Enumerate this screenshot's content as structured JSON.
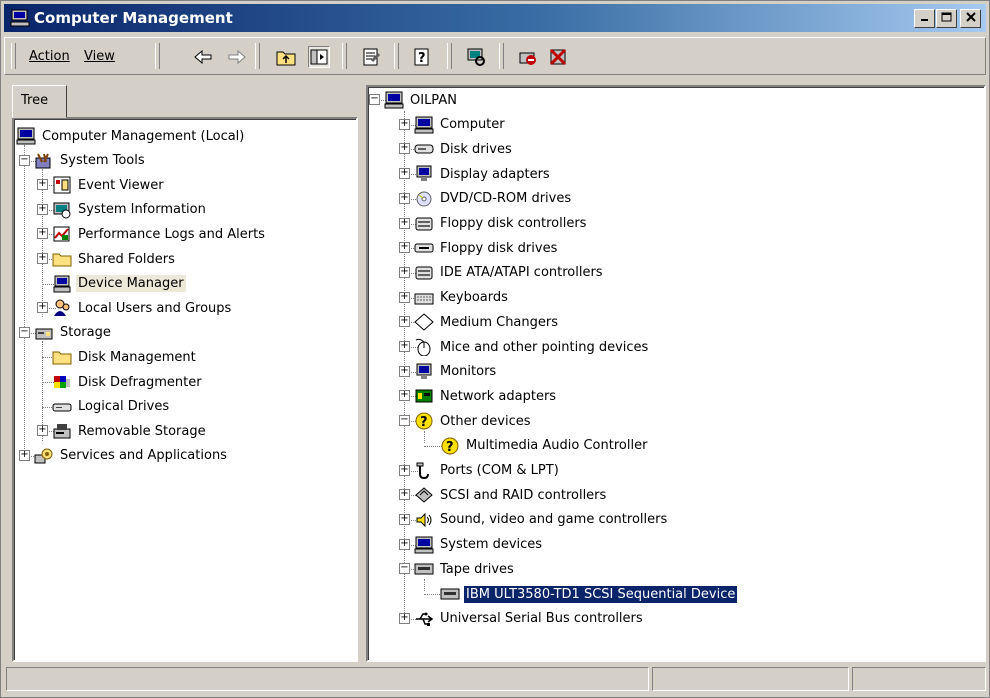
{
  "window": {
    "title": "Computer Management"
  },
  "menu": {
    "action": "Action",
    "view": "View"
  },
  "tab": {
    "tree": "Tree"
  },
  "left_tree": [
    {
      "label": "Computer Management (Local)",
      "icon": "computer-icon"
    },
    {
      "label": "System Tools",
      "icon": "tools-icon",
      "expander": "−"
    },
    {
      "label": "Event Viewer",
      "icon": "event-viewer-icon",
      "expander": "+"
    },
    {
      "label": "System Information",
      "icon": "system-info-icon",
      "expander": "+"
    },
    {
      "label": "Performance Logs and Alerts",
      "icon": "performance-icon",
      "expander": "+"
    },
    {
      "label": "Shared Folders",
      "icon": "folder-icon",
      "expander": "+"
    },
    {
      "label": "Device Manager",
      "icon": "device-manager-icon"
    },
    {
      "label": "Local Users and Groups",
      "icon": "users-icon",
      "expander": "+"
    },
    {
      "label": "Storage",
      "icon": "storage-icon",
      "expander": "−"
    },
    {
      "label": "Disk Management",
      "icon": "disk-management-icon"
    },
    {
      "label": "Disk Defragmenter",
      "icon": "defrag-icon"
    },
    {
      "label": "Logical Drives",
      "icon": "drive-icon"
    },
    {
      "label": "Removable Storage",
      "icon": "removable-storage-icon",
      "expander": "+"
    },
    {
      "label": "Services and Applications",
      "icon": "services-icon",
      "expander": "+"
    }
  ],
  "device_tree": [
    {
      "label": "OILPAN",
      "icon": "computer-icon",
      "expander": "−"
    },
    {
      "label": "Computer",
      "icon": "computer-icon",
      "expander": "+"
    },
    {
      "label": "Disk drives",
      "icon": "disk-drive-icon",
      "expander": "+"
    },
    {
      "label": "Display adapters",
      "icon": "monitor-icon",
      "expander": "+"
    },
    {
      "label": "DVD/CD-ROM drives",
      "icon": "cd-icon",
      "expander": "+"
    },
    {
      "label": "Floppy disk controllers",
      "icon": "controller-icon",
      "expander": "+"
    },
    {
      "label": "Floppy disk drives",
      "icon": "floppy-drive-icon",
      "expander": "+"
    },
    {
      "label": "IDE ATA/ATAPI controllers",
      "icon": "controller-icon",
      "expander": "+"
    },
    {
      "label": "Keyboards",
      "icon": "keyboard-icon",
      "expander": "+"
    },
    {
      "label": "Medium Changers",
      "icon": "medium-changer-icon",
      "expander": "+"
    },
    {
      "label": "Mice and other pointing devices",
      "icon": "mouse-icon",
      "expander": "+"
    },
    {
      "label": "Monitors",
      "icon": "monitor-icon",
      "expander": "+"
    },
    {
      "label": "Network adapters",
      "icon": "network-adapter-icon",
      "expander": "+"
    },
    {
      "label": "Other devices",
      "icon": "unknown-device-icon",
      "expander": "−"
    },
    {
      "label": "Multimedia Audio Controller",
      "icon": "unknown-device-icon"
    },
    {
      "label": "Ports (COM & LPT)",
      "icon": "port-icon",
      "expander": "+"
    },
    {
      "label": "SCSI and RAID controllers",
      "icon": "scsi-icon",
      "expander": "+"
    },
    {
      "label": "Sound, video and game controllers",
      "icon": "sound-icon",
      "expander": "+"
    },
    {
      "label": "System devices",
      "icon": "computer-icon",
      "expander": "+"
    },
    {
      "label": "Tape drives",
      "icon": "tape-drive-icon",
      "expander": "−"
    },
    {
      "label": "IBM ULT3580-TD1 SCSI Sequential Device",
      "icon": "tape-drive-icon"
    },
    {
      "label": "Universal Serial Bus controllers",
      "icon": "usb-icon",
      "expander": "+"
    }
  ],
  "colors": {
    "title_start": "#0a246a",
    "title_end": "#a6caf0",
    "selection": "#0a246a",
    "chrome": "#d4d0c8"
  }
}
